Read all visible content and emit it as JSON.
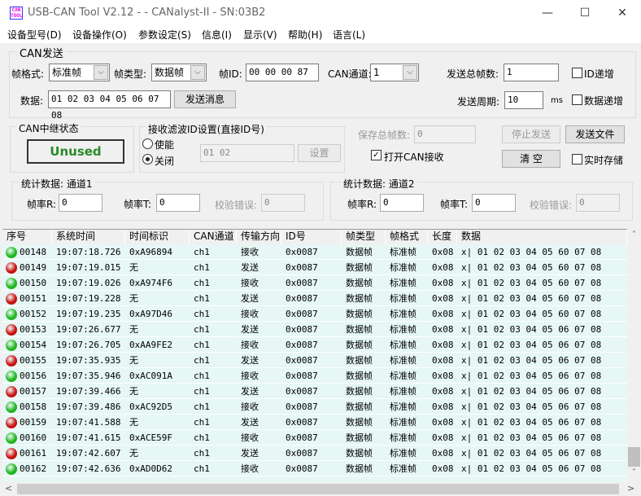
{
  "window": {
    "title": "USB-CAN Tool V2.12 -   - CANalyst-II - SN:03B2",
    "logo_text": "CAN TOOL",
    "minimize": "—",
    "maximize": "☐",
    "close": "✕"
  },
  "menu": [
    "设备型号(D)",
    "设备操作(O)",
    "参数设定(S)",
    "信息(I)",
    "显示(V)",
    "帮助(H)",
    "语言(L)"
  ],
  "send": {
    "group_label": "CAN发送",
    "frame_format_label": "帧格式:",
    "frame_format": "标准帧",
    "frame_type_label": "帧类型:",
    "frame_type": "数据帧",
    "frame_id_label": "帧ID:",
    "frame_id": "00 00 00 87",
    "channel_label": "CAN通道:",
    "channel": "1",
    "total_label": "发送总帧数:",
    "total": "1",
    "id_inc_label": "ID递增",
    "data_label": "数据:",
    "data": "01 02 03 04 05 06 07 08",
    "send_button": "发送消息",
    "period_label": "发送周期:",
    "period": "10",
    "period_unit": "ms",
    "data_inc_label": "数据递增"
  },
  "relay": {
    "group_label": "CAN中继状态",
    "status": "Unused",
    "status_color": "#2a8a2a"
  },
  "filter": {
    "group_label": "接收滤波ID设置(直接ID号)",
    "enable_label": "使能",
    "disable_label": "关闭",
    "selected": "关闭",
    "ids": "01 02",
    "set_button": "设置"
  },
  "controls": {
    "saved_label": "保存总帧数:",
    "saved": "0",
    "stop_button": "停止发送",
    "send_file_button": "发送文件",
    "open_receive_label": "打开CAN接收",
    "open_receive_checked": true,
    "clear_button": "清 空",
    "realtime_save_label": "实时存储",
    "realtime_save_checked": false
  },
  "stats": [
    {
      "group_label": "统计数据: 通道1",
      "rate_r_label": "帧率R:",
      "rate_r": "0",
      "rate_t_label": "帧率T:",
      "rate_t": "0",
      "err_label": "校验错误:",
      "err": "0"
    },
    {
      "group_label": "统计数据: 通道2",
      "rate_r_label": "帧率R:",
      "rate_r": "0",
      "rate_t_label": "帧率T:",
      "rate_t": "0",
      "err_label": "校验错误:",
      "err": "0"
    }
  ],
  "table": {
    "columns": [
      "序号",
      "系统时间",
      "时间标识",
      "CAN通道",
      "传输方向",
      "ID号",
      "帧类型",
      "帧格式",
      "长度",
      "数据"
    ],
    "colors": {
      "receive": "#1fb51f",
      "send": "#c81010"
    },
    "rows": [
      [
        "00148",
        "19:07:18.726",
        "0xA96894",
        "ch1",
        "接收",
        "0x0087",
        "数据帧",
        "标准帧",
        "0x08",
        "x| 01 02 03 04 05 60 07 08"
      ],
      [
        "00149",
        "19:07:19.015",
        "无",
        "ch1",
        "发送",
        "0x0087",
        "数据帧",
        "标准帧",
        "0x08",
        "x| 01 02 03 04 05 60 07 08"
      ],
      [
        "00150",
        "19:07:19.026",
        "0xA974F6",
        "ch1",
        "接收",
        "0x0087",
        "数据帧",
        "标准帧",
        "0x08",
        "x| 01 02 03 04 05 60 07 08"
      ],
      [
        "00151",
        "19:07:19.228",
        "无",
        "ch1",
        "发送",
        "0x0087",
        "数据帧",
        "标准帧",
        "0x08",
        "x| 01 02 03 04 05 60 07 08"
      ],
      [
        "00152",
        "19:07:19.235",
        "0xA97D46",
        "ch1",
        "接收",
        "0x0087",
        "数据帧",
        "标准帧",
        "0x08",
        "x| 01 02 03 04 05 60 07 08"
      ],
      [
        "00153",
        "19:07:26.677",
        "无",
        "ch1",
        "发送",
        "0x0087",
        "数据帧",
        "标准帧",
        "0x08",
        "x| 01 02 03 04 05 06 07 08"
      ],
      [
        "00154",
        "19:07:26.705",
        "0xAA9FE2",
        "ch1",
        "接收",
        "0x0087",
        "数据帧",
        "标准帧",
        "0x08",
        "x| 01 02 03 04 05 06 07 08"
      ],
      [
        "00155",
        "19:07:35.935",
        "无",
        "ch1",
        "发送",
        "0x0087",
        "数据帧",
        "标准帧",
        "0x08",
        "x| 01 02 03 04 05 06 07 08"
      ],
      [
        "00156",
        "19:07:35.946",
        "0xAC091A",
        "ch1",
        "接收",
        "0x0087",
        "数据帧",
        "标准帧",
        "0x08",
        "x| 01 02 03 04 05 06 07 08"
      ],
      [
        "00157",
        "19:07:39.466",
        "无",
        "ch1",
        "发送",
        "0x0087",
        "数据帧",
        "标准帧",
        "0x08",
        "x| 01 02 03 04 05 06 07 08"
      ],
      [
        "00158",
        "19:07:39.486",
        "0xAC92D5",
        "ch1",
        "接收",
        "0x0087",
        "数据帧",
        "标准帧",
        "0x08",
        "x| 01 02 03 04 05 06 07 08"
      ],
      [
        "00159",
        "19:07:41.588",
        "无",
        "ch1",
        "发送",
        "0x0087",
        "数据帧",
        "标准帧",
        "0x08",
        "x| 01 02 03 04 05 06 07 08"
      ],
      [
        "00160",
        "19:07:41.615",
        "0xACE59F",
        "ch1",
        "接收",
        "0x0087",
        "数据帧",
        "标准帧",
        "0x08",
        "x| 01 02 03 04 05 06 07 08"
      ],
      [
        "00161",
        "19:07:42.607",
        "无",
        "ch1",
        "发送",
        "0x0087",
        "数据帧",
        "标准帧",
        "0x08",
        "x| 01 02 03 04 05 06 07 08"
      ],
      [
        "00162",
        "19:07:42.636",
        "0xAD0D62",
        "ch1",
        "接收",
        "0x0087",
        "数据帧",
        "标准帧",
        "0x08",
        "x| 01 02 03 04 05 06 07 08"
      ]
    ]
  },
  "scroll": {
    "up": "˄",
    "down": "˅",
    "left": "<",
    "right": ">"
  }
}
